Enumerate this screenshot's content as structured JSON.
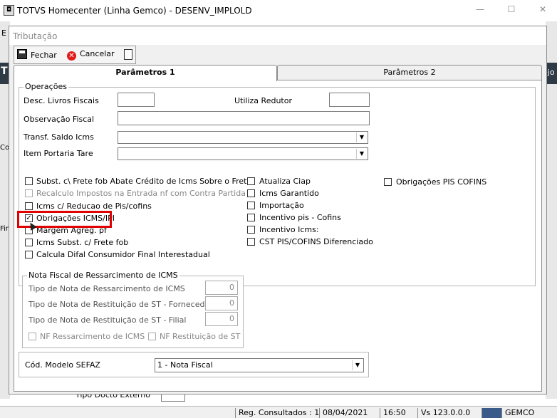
{
  "window": {
    "title": "TOTVS Homecenter (Linha Gemco) - DESENV_IMPLOLD",
    "controls": {
      "minimize": "—",
      "maximize": "☐",
      "close": "✕"
    }
  },
  "background": {
    "left_letters": [
      "E",
      "T",
      "Co",
      "Fin"
    ],
    "right_text": "ejo",
    "bottom_label": "Tipo Docto Externo"
  },
  "statusbar": {
    "regs": "Reg. Consultados : 1",
    "date": "08/04/2021",
    "time": "16:50",
    "version": "Vs 123.0.0.0",
    "user": "GEMCO"
  },
  "dialog": {
    "title": "Tributação",
    "toolbar": {
      "close_label": "Fechar",
      "cancel_label": "Cancelar"
    },
    "tabs": [
      {
        "label": "Parâmetros 1",
        "active": true
      },
      {
        "label": "Parâmetros 2",
        "active": false
      }
    ]
  },
  "operacoes": {
    "legend": "Operações",
    "desc_livros_label": "Desc. Livros Fiscais",
    "desc_livros_value": "",
    "utiliza_redutor_label": "Utiliza Redutor",
    "utiliza_redutor_value": "",
    "observacao_label": "Observação Fiscal",
    "observacao_value": "",
    "transf_saldo_label": "Transf. Saldo Icms",
    "transf_saldo_value": "",
    "item_portaria_label": "Item Portaria Tare",
    "item_portaria_value": "",
    "checkboxes_col1": [
      {
        "label": "Subst. c\\ Frete fob Abate Crédito de Icms Sobre o Frete",
        "checked": false,
        "enabled": true
      },
      {
        "label": "Recalculo Impostos na Entrada nf com Contra Partida",
        "checked": false,
        "enabled": false
      },
      {
        "label": "Icms c/ Reducao de Pis/cofins",
        "checked": false,
        "enabled": true
      },
      {
        "label": "Obrigações ICMS/IPI",
        "checked": true,
        "enabled": true
      },
      {
        "label": "Margem Agreg. pf",
        "checked": false,
        "enabled": true
      },
      {
        "label": "Icms Subst. c/ Frete fob",
        "checked": false,
        "enabled": true
      },
      {
        "label": "Calcula Difal Consumidor Final Interestadual",
        "checked": false,
        "enabled": true
      }
    ],
    "checkboxes_col2": [
      {
        "label": "Atualiza Ciap",
        "checked": false
      },
      {
        "label": "Icms Garantido",
        "checked": false
      },
      {
        "label": "Importação",
        "checked": false
      },
      {
        "label": "Incentivo pis - Cofins",
        "checked": false
      },
      {
        "label": "Incentivo Icms:",
        "checked": false
      },
      {
        "label": "CST PIS/COFINS Diferenciado",
        "checked": false
      }
    ],
    "checkboxes_col3": [
      {
        "label": "Obrigações PIS COFINS",
        "checked": false
      }
    ]
  },
  "nf_ressarcimento": {
    "legend": "Nota Fiscal de Ressarcimento de ICMS",
    "rows": [
      {
        "label": "Tipo de Nota de Ressarcimento de ICMS",
        "value": "0"
      },
      {
        "label": "Tipo de Nota de Restituição de ST - Fornecedor",
        "value": "0"
      },
      {
        "label": "Tipo de Nota de Restituição de ST - Filial",
        "value": "0"
      }
    ],
    "cb_ressarcimento": "NF Ressarcimento de ICMS",
    "cb_restituicao": "NF Restituição de ST"
  },
  "sefaz": {
    "label": "Cód. Modelo SEFAZ",
    "value": "1 - Nota Fiscal"
  },
  "colors": {
    "highlight": "#e00000",
    "dark_strip": "#2e3a46"
  }
}
